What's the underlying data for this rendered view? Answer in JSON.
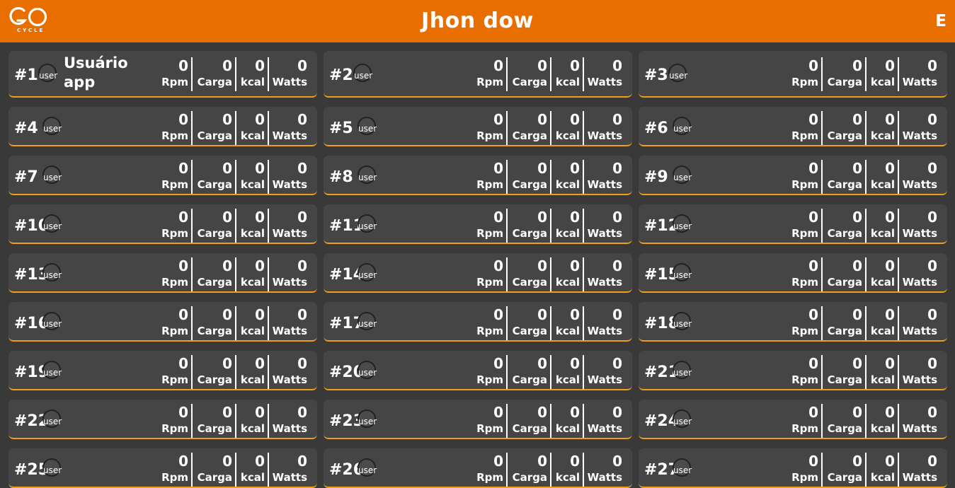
{
  "header": {
    "logo_text": "GO",
    "logo_subtext": "CYCLE",
    "title": "Jhon dow",
    "initial": "E",
    "colors": {
      "header_bg": "#e96e00",
      "card_bg": "#464545",
      "accent": "#f0a018"
    }
  },
  "metric_labels": {
    "rpm": "Rpm",
    "carga": "Carga",
    "kcal": "kcal",
    "watts": "Watts"
  },
  "avatar_alt": "user",
  "bikes": [
    {
      "number": "#1",
      "user": "Usuário app",
      "rpm": "0",
      "carga": "0",
      "kcal": "0",
      "watts": "0"
    },
    {
      "number": "#2",
      "user": "",
      "rpm": "0",
      "carga": "0",
      "kcal": "0",
      "watts": "0"
    },
    {
      "number": "#3",
      "user": "",
      "rpm": "0",
      "carga": "0",
      "kcal": "0",
      "watts": "0"
    },
    {
      "number": "#4",
      "user": "",
      "rpm": "0",
      "carga": "0",
      "kcal": "0",
      "watts": "0"
    },
    {
      "number": "#5",
      "user": "",
      "rpm": "0",
      "carga": "0",
      "kcal": "0",
      "watts": "0"
    },
    {
      "number": "#6",
      "user": "",
      "rpm": "0",
      "carga": "0",
      "kcal": "0",
      "watts": "0"
    },
    {
      "number": "#7",
      "user": "",
      "rpm": "0",
      "carga": "0",
      "kcal": "0",
      "watts": "0"
    },
    {
      "number": "#8",
      "user": "",
      "rpm": "0",
      "carga": "0",
      "kcal": "0",
      "watts": "0"
    },
    {
      "number": "#9",
      "user": "",
      "rpm": "0",
      "carga": "0",
      "kcal": "0",
      "watts": "0"
    },
    {
      "number": "#10",
      "user": "",
      "rpm": "0",
      "carga": "0",
      "kcal": "0",
      "watts": "0"
    },
    {
      "number": "#11",
      "user": "",
      "rpm": "0",
      "carga": "0",
      "kcal": "0",
      "watts": "0"
    },
    {
      "number": "#12",
      "user": "",
      "rpm": "0",
      "carga": "0",
      "kcal": "0",
      "watts": "0"
    },
    {
      "number": "#13",
      "user": "",
      "rpm": "0",
      "carga": "0",
      "kcal": "0",
      "watts": "0"
    },
    {
      "number": "#14",
      "user": "",
      "rpm": "0",
      "carga": "0",
      "kcal": "0",
      "watts": "0"
    },
    {
      "number": "#15",
      "user": "",
      "rpm": "0",
      "carga": "0",
      "kcal": "0",
      "watts": "0"
    },
    {
      "number": "#16",
      "user": "",
      "rpm": "0",
      "carga": "0",
      "kcal": "0",
      "watts": "0"
    },
    {
      "number": "#17",
      "user": "",
      "rpm": "0",
      "carga": "0",
      "kcal": "0",
      "watts": "0"
    },
    {
      "number": "#18",
      "user": "",
      "rpm": "0",
      "carga": "0",
      "kcal": "0",
      "watts": "0"
    },
    {
      "number": "#19",
      "user": "",
      "rpm": "0",
      "carga": "0",
      "kcal": "0",
      "watts": "0"
    },
    {
      "number": "#20",
      "user": "",
      "rpm": "0",
      "carga": "0",
      "kcal": "0",
      "watts": "0"
    },
    {
      "number": "#21",
      "user": "",
      "rpm": "0",
      "carga": "0",
      "kcal": "0",
      "watts": "0"
    },
    {
      "number": "#22",
      "user": "",
      "rpm": "0",
      "carga": "0",
      "kcal": "0",
      "watts": "0"
    },
    {
      "number": "#23",
      "user": "",
      "rpm": "0",
      "carga": "0",
      "kcal": "0",
      "watts": "0"
    },
    {
      "number": "#24",
      "user": "",
      "rpm": "0",
      "carga": "0",
      "kcal": "0",
      "watts": "0"
    },
    {
      "number": "#25",
      "user": "",
      "rpm": "0",
      "carga": "0",
      "kcal": "0",
      "watts": "0"
    },
    {
      "number": "#26",
      "user": "",
      "rpm": "0",
      "carga": "0",
      "kcal": "0",
      "watts": "0"
    },
    {
      "number": "#27",
      "user": "",
      "rpm": "0",
      "carga": "0",
      "kcal": "0",
      "watts": "0"
    }
  ]
}
